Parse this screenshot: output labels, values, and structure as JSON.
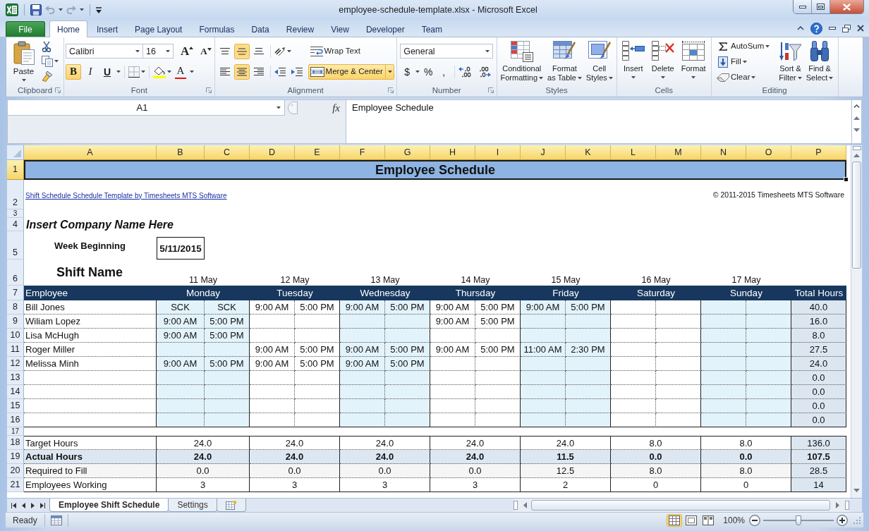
{
  "window": {
    "title": "employee-schedule-template.xlsx - Microsoft Excel"
  },
  "quick_access": [
    {
      "disabled": false
    },
    {
      "disabled": true
    },
    {
      "disabled": true
    }
  ],
  "ribbon_tabs": [
    {
      "label": "File",
      "kind": "file",
      "selected": false
    },
    {
      "label": "Home",
      "kind": "tab",
      "selected": true
    },
    {
      "label": "Insert",
      "kind": "tab",
      "selected": false
    },
    {
      "label": "Page Layout",
      "kind": "tab",
      "selected": false
    },
    {
      "label": "Formulas",
      "kind": "tab",
      "selected": false
    },
    {
      "label": "Data",
      "kind": "tab",
      "selected": false
    },
    {
      "label": "Review",
      "kind": "tab",
      "selected": false
    },
    {
      "label": "View",
      "kind": "tab",
      "selected": false
    },
    {
      "label": "Developer",
      "kind": "tab",
      "selected": false
    },
    {
      "label": "Team",
      "kind": "tab",
      "selected": false
    }
  ],
  "ribbon": {
    "clipboard": {
      "label": "Clipboard",
      "paste": "Paste"
    },
    "font": {
      "label": "Font",
      "font_name": "Calibri",
      "font_size": "16",
      "grow_font": "A",
      "shrink_font": "A",
      "styles": [
        {
          "label": "B",
          "selected": true
        },
        {
          "label": "I",
          "selected": false
        },
        {
          "label": "U",
          "selected": false
        }
      ],
      "font_color": "A"
    },
    "alignment": {
      "label": "Alignment",
      "vertical": [
        {
          "selected": false
        },
        {
          "selected": true
        },
        {
          "selected": false
        }
      ],
      "horizontal": [
        {
          "selected": false
        },
        {
          "selected": true
        },
        {
          "selected": false
        }
      ],
      "wrap_text": {
        "label": "Wrap Text",
        "selected": false
      },
      "merge_center": {
        "label": "Merge & Center",
        "selected": true
      }
    },
    "number": {
      "label": "Number",
      "format": "General",
      "symbols": [
        "$",
        "%",
        ","
      ]
    },
    "styles": {
      "label": "Styles",
      "buttons": [
        "Conditional\nFormatting",
        "Format\nas Table",
        "Cell\nStyles"
      ]
    },
    "cells": {
      "label": "Cells",
      "buttons": [
        "Insert",
        "Delete",
        "Format"
      ]
    },
    "editing": {
      "label": "Editing",
      "small_buttons": [
        "AutoSum",
        "Fill",
        "Clear"
      ],
      "large_buttons": [
        "Sort &\nFilter",
        "Find &\nSelect"
      ]
    }
  },
  "formula_bar": {
    "name_box": "A1",
    "function_button": "fx",
    "formula": "Employee Schedule"
  },
  "sheet": {
    "columns": [
      {
        "label": "A",
        "selected": true
      },
      {
        "label": "B",
        "selected": true
      },
      {
        "label": "C",
        "selected": true
      },
      {
        "label": "D",
        "selected": true
      },
      {
        "label": "E",
        "selected": true
      },
      {
        "label": "F",
        "selected": true
      },
      {
        "label": "G",
        "selected": true
      },
      {
        "label": "H",
        "selected": true
      },
      {
        "label": "I",
        "selected": true
      },
      {
        "label": "J",
        "selected": true
      },
      {
        "label": "K",
        "selected": true
      },
      {
        "label": "L",
        "selected": true
      },
      {
        "label": "M",
        "selected": true
      },
      {
        "label": "N",
        "selected": true
      },
      {
        "label": "O",
        "selected": true
      },
      {
        "label": "P",
        "selected": true
      }
    ],
    "rows": [
      {
        "label": "1",
        "selected": true
      },
      {
        "label": "2",
        "selected": false
      },
      {
        "label": "3",
        "selected": false
      },
      {
        "label": "4",
        "selected": false
      },
      {
        "label": "5",
        "selected": false
      },
      {
        "label": "6",
        "selected": false
      },
      {
        "label": "7",
        "selected": false
      },
      {
        "label": "8",
        "selected": false
      },
      {
        "label": "9",
        "selected": false
      },
      {
        "label": "10",
        "selected": false
      },
      {
        "label": "11",
        "selected": false
      },
      {
        "label": "12",
        "selected": false
      },
      {
        "label": "13",
        "selected": false
      },
      {
        "label": "14",
        "selected": false
      },
      {
        "label": "15",
        "selected": false
      },
      {
        "label": "16",
        "selected": false
      },
      {
        "label": "17",
        "selected": false
      },
      {
        "label": "18",
        "selected": false
      },
      {
        "label": "19",
        "selected": false
      },
      {
        "label": "20",
        "selected": false
      },
      {
        "label": "21",
        "selected": false
      }
    ],
    "title": "Employee Schedule",
    "template_link": "Shift Schedule Schedule Template by Timesheets MTS Software",
    "copyright": "© 2011-2015 Timesheets MTS Software",
    "company": "Insert Company Name Here",
    "week_label": "Week Beginning",
    "week_start": "5/11/2015",
    "shift_label": "Shift Name",
    "employee_heading": "Employee",
    "total_heading": "Total Hours",
    "days": [
      {
        "date": "11 May",
        "name": "Monday"
      },
      {
        "date": "12 May",
        "name": "Tuesday"
      },
      {
        "date": "13 May",
        "name": "Wednesday"
      },
      {
        "date": "14 May",
        "name": "Thursday"
      },
      {
        "date": "15 May",
        "name": "Friday"
      },
      {
        "date": "16 May",
        "name": "Saturday"
      },
      {
        "date": "17 May",
        "name": "Sunday"
      }
    ],
    "employees": [
      {
        "name": "Bill Jones",
        "shifts": {
          "monday": {
            "start": "SCK",
            "end": "SCK"
          },
          "tuesday": {
            "start": "9:00 AM",
            "end": "5:00 PM"
          },
          "wednesday": {
            "start": "9:00 AM",
            "end": "5:00 PM"
          },
          "thursday": {
            "start": "9:00 AM",
            "end": "5:00 PM"
          },
          "friday": {
            "start": "9:00 AM",
            "end": "5:00 PM"
          }
        },
        "total": "40.0"
      },
      {
        "name": "Wiliam Lopez",
        "shifts": {
          "monday": {
            "start": "9:00 AM",
            "end": "5:00 PM"
          },
          "thursday": {
            "start": "9:00 AM",
            "end": "5:00 PM"
          }
        },
        "total": "16.0"
      },
      {
        "name": "Lisa McHugh",
        "shifts": {
          "monday": {
            "start": "9:00 AM",
            "end": "5:00 PM"
          }
        },
        "total": "8.0"
      },
      {
        "name": "Roger Miller",
        "shifts": {
          "tuesday": {
            "start": "9:00 AM",
            "end": "5:00 PM"
          },
          "wednesday": {
            "start": "9:00 AM",
            "end": "5:00 PM"
          },
          "thursday": {
            "start": "9:00 AM",
            "end": "5:00 PM"
          },
          "friday": {
            "start": "11:00 AM",
            "end": "2:30 PM"
          }
        },
        "total": "27.5"
      },
      {
        "name": "Melissa Minh",
        "shifts": {
          "monday": {
            "start": "9:00 AM",
            "end": "5:00 PM"
          },
          "tuesday": {
            "start": "9:00 AM",
            "end": "5:00 PM"
          },
          "wednesday": {
            "start": "9:00 AM",
            "end": "5:00 PM"
          }
        },
        "total": "24.0"
      },
      {
        "total": "0.0"
      },
      {
        "total": "0.0"
      },
      {
        "total": "0.0"
      },
      {
        "total": "0.0"
      }
    ],
    "summary": [
      {
        "label": "Target Hours",
        "kind": "plain",
        "values": [
          "24.0",
          "24.0",
          "24.0",
          "24.0",
          "24.0",
          "8.0",
          "8.0"
        ],
        "total": "136.0"
      },
      {
        "label": "Actual Hours",
        "kind": "total",
        "values": [
          "24.0",
          "24.0",
          "24.0",
          "24.0",
          "11.5",
          "0.0",
          "0.0"
        ],
        "total": "107.5"
      },
      {
        "label": "Required to Fill",
        "kind": "shaded",
        "values": [
          "0.0",
          "0.0",
          "0.0",
          "0.0",
          "12.5",
          "8.0",
          "8.0"
        ],
        "total": "28.5"
      },
      {
        "label": "Employees Working",
        "kind": "plain",
        "values": [
          "3",
          "3",
          "3",
          "3",
          "2",
          "0",
          "0"
        ],
        "total": "14"
      }
    ]
  },
  "sheet_tabs": [
    {
      "label": "Employee Shift Schedule",
      "selected": true
    },
    {
      "label": "Settings",
      "selected": false
    }
  ],
  "status_bar": {
    "status": "Ready",
    "views": [
      {
        "selected": true
      },
      {
        "selected": false
      },
      {
        "selected": false
      }
    ],
    "zoom": "100%",
    "zoom_slider": {
      "level": 0.5
    }
  }
}
